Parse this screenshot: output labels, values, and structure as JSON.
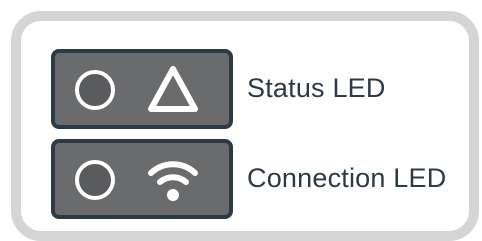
{
  "leds": {
    "status": {
      "label": "Status LED",
      "icon": "warning-triangle-icon"
    },
    "connection": {
      "label": "Connection LED",
      "icon": "wifi-icon"
    }
  },
  "colors": {
    "panel_border": "#d5d5d5",
    "led_box_fill": "#6a6b6d",
    "led_box_border": "#2c3a46",
    "icon": "#ffffff",
    "label_text": "#2c3a46"
  }
}
